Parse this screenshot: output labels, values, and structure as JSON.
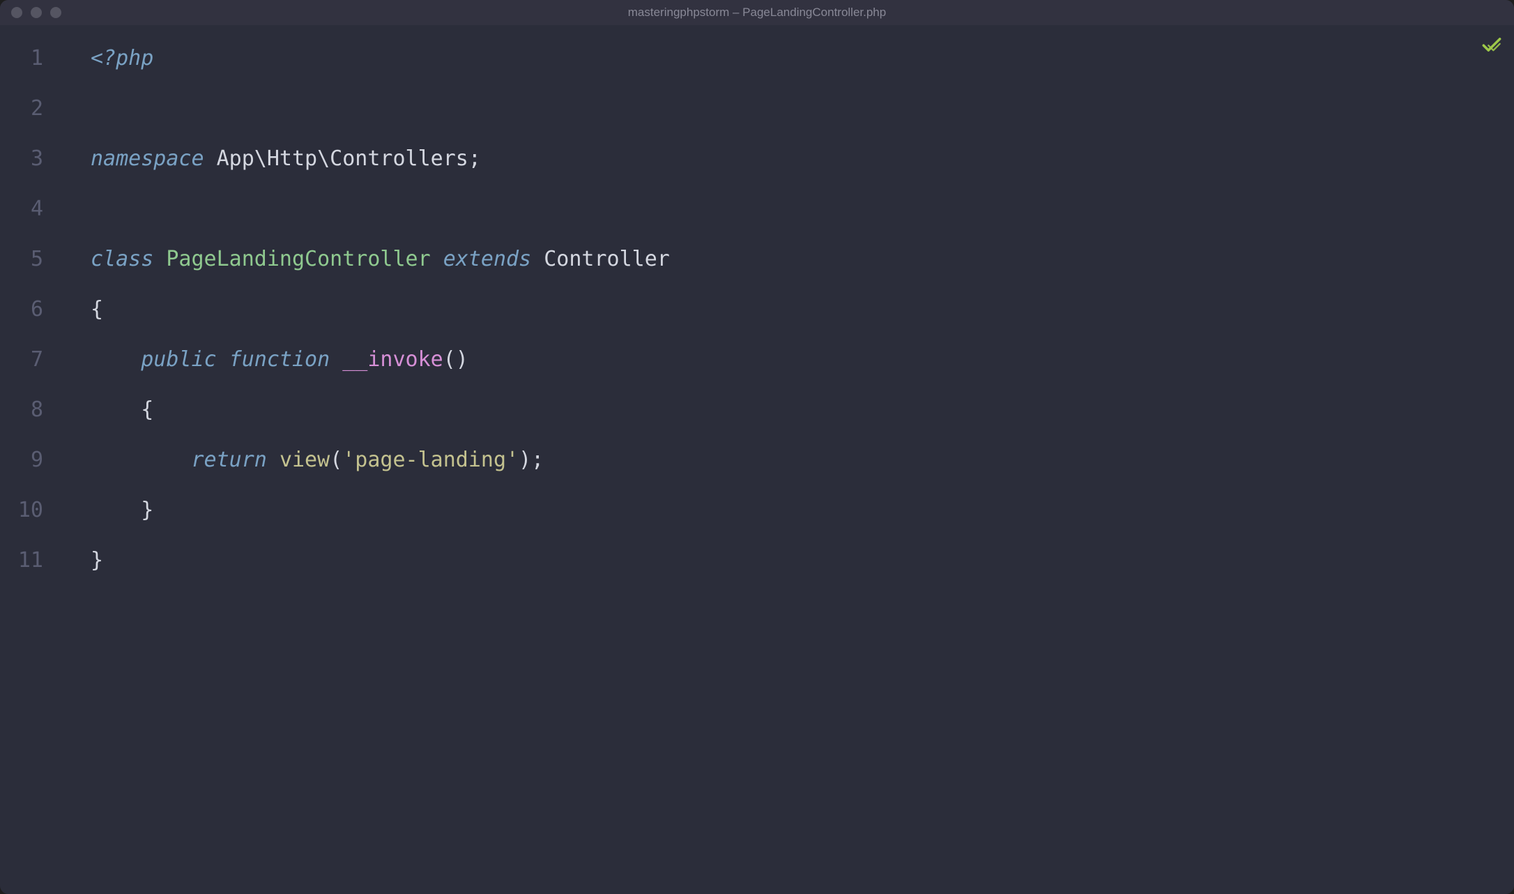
{
  "window": {
    "title": "masteringphpstorm – PageLandingController.php"
  },
  "editor": {
    "lineNumbers": [
      "1",
      "2",
      "3",
      "4",
      "5",
      "6",
      "7",
      "8",
      "9",
      "10",
      "11"
    ],
    "lines": [
      [
        {
          "cls": "tok-php-tag",
          "text": "<?php"
        }
      ],
      [],
      [
        {
          "cls": "tok-keyword",
          "text": "namespace"
        },
        {
          "cls": "tok-text",
          "text": " App\\Http\\Controllers;"
        }
      ],
      [],
      [
        {
          "cls": "tok-keyword",
          "text": "class"
        },
        {
          "cls": "tok-text",
          "text": " "
        },
        {
          "cls": "tok-classname",
          "text": "PageLandingController"
        },
        {
          "cls": "tok-text",
          "text": " "
        },
        {
          "cls": "tok-keyword",
          "text": "extends"
        },
        {
          "cls": "tok-text",
          "text": " Controller"
        }
      ],
      [
        {
          "cls": "tok-brace",
          "text": "{"
        }
      ],
      [
        {
          "cls": "tok-text",
          "text": "    "
        },
        {
          "cls": "tok-keyword",
          "text": "public"
        },
        {
          "cls": "tok-text",
          "text": " "
        },
        {
          "cls": "tok-keyword",
          "text": "function"
        },
        {
          "cls": "tok-text",
          "text": " "
        },
        {
          "cls": "tok-method-magic",
          "text": "__invoke"
        },
        {
          "cls": "tok-punct",
          "text": "()"
        }
      ],
      [
        {
          "cls": "tok-text",
          "text": "    "
        },
        {
          "cls": "tok-brace",
          "text": "{"
        }
      ],
      [
        {
          "cls": "tok-text",
          "text": "        "
        },
        {
          "cls": "tok-keyword",
          "text": "return"
        },
        {
          "cls": "tok-text",
          "text": " "
        },
        {
          "cls": "tok-function-call",
          "text": "view"
        },
        {
          "cls": "tok-punct",
          "text": "("
        },
        {
          "cls": "tok-string",
          "text": "'page-landing'"
        },
        {
          "cls": "tok-punct",
          "text": ");"
        }
      ],
      [
        {
          "cls": "tok-text",
          "text": "    "
        },
        {
          "cls": "tok-brace",
          "text": "}"
        }
      ],
      [
        {
          "cls": "tok-brace",
          "text": "}"
        }
      ]
    ]
  },
  "status": {
    "analysisOk": true
  }
}
